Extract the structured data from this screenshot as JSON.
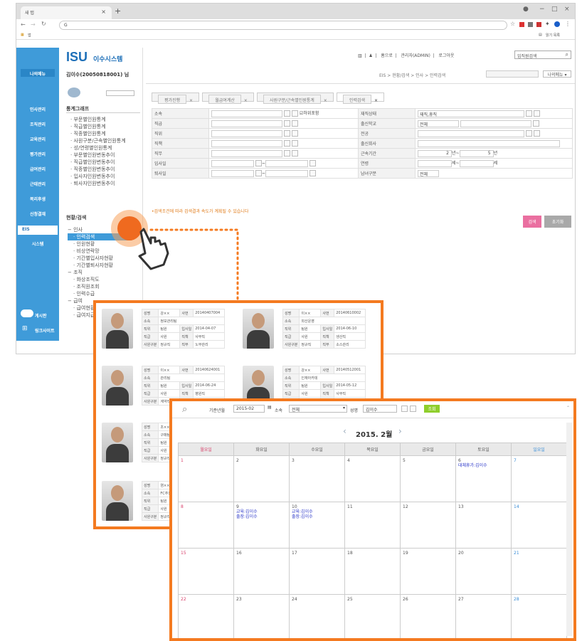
{
  "browser": {
    "tab_title": "새 탭",
    "tab_close": "×",
    "new_tab": "+",
    "url": "G",
    "bookmark_apps": "앱",
    "reading_list": "읽기 목록",
    "window_controls": [
      "−",
      "□",
      "×"
    ]
  },
  "brand": {
    "logo": "ISU",
    "name": "이수시스템",
    "user": "김이수(20050818001) 님",
    "my_menu": "나의메뉴"
  },
  "header": {
    "links": [
      "홈으로",
      "관리자(ADMIN)",
      "로그아웃"
    ],
    "search_placeholder": "임직원검색",
    "breadcrumb": "EIS > 현황/검색 > 인사 > 인력검색",
    "my_menu_btn": "나의메뉴 ▾"
  },
  "leftnav": [
    "인사관리",
    "조직관리",
    "교육관리",
    "평가관리",
    "급여관리",
    "근태관리",
    "복리후생",
    "신청결재",
    "EIS",
    "시스템"
  ],
  "leftnav_bottom": [
    "게시판",
    "링크사이트"
  ],
  "lnb": {
    "stats_title": "통계그래프",
    "stats": [
      "부문별인원통계",
      "직급별인원통계",
      "직종별인원통계",
      "사원구분/근속별인원통계",
      "성/연령별인원통계",
      "부문별인원변동추이",
      "직급별인원변동추이",
      "직종별인원변동추이",
      "입사자인원변동추이",
      "퇴사자인원변동추이"
    ],
    "status_title": "현황/검색",
    "groups": [
      {
        "name": "인사",
        "items": [
          "인력검색",
          "인원현황",
          "비상연락망",
          "기간별입사자현황",
          "기간별퇴사자현황"
        ]
      },
      {
        "name": "조직",
        "items": [
          "화상조직도",
          "조직원조회",
          "인력수급"
        ]
      },
      {
        "name": "급여",
        "items": [
          "급여현황",
          "급여지급"
        ]
      }
    ]
  },
  "tabs": [
    "평가진행",
    "월급여계산",
    "사원구분/근속별인원통계",
    "인력검색"
  ],
  "form": {
    "left": [
      "소속",
      "직급",
      "직위",
      "직책",
      "직무",
      "입사일",
      "퇴사일"
    ],
    "right": [
      "재직상태",
      "출신학교",
      "전공",
      "출신회사",
      "근속기간",
      "연령",
      "남녀구분"
    ],
    "include_sub": "하위포함",
    "status_value": "재직,휴직",
    "school_value": "전체",
    "tenure_from": "2",
    "tenure_unit_year": "년~",
    "tenure_to": "5",
    "tenure_unit": "년",
    "age_unit_a": "세~",
    "age_unit_b": "세",
    "gender_value": "전체",
    "tilde": "~",
    "notice": "•검색조건에 따라 검색결과 속도가 계획될 수 있습니다",
    "search_btn": "검색",
    "reset_btn": "초기화"
  },
  "profile_labels": {
    "name": "성명",
    "empno": "사번",
    "dept": "소속",
    "position": "직위",
    "hire": "입사일",
    "grade": "직급",
    "duty": "직책",
    "type": "사원구분",
    "job": "직무"
  },
  "profiles": [
    {
      "name": "강××",
      "empno": "20140407004",
      "dept": "정보관리팀",
      "position": "팀원",
      "hire": "2014-04-07",
      "grade": "사원",
      "duty": "사무직",
      "type": "정규직",
      "job": "노무관리"
    },
    {
      "name": "이××",
      "empno": "20140610002",
      "dept": "외산운영",
      "position": "팀원",
      "hire": "2014-06-10",
      "grade": "사원",
      "duty": "생산직",
      "type": "정규직",
      "job": "소스관리"
    },
    {
      "name": "이××",
      "empno": "20140624001",
      "dept": "관리팀",
      "position": "팀원",
      "hire": "2014-06-24",
      "grade": "사원",
      "duty": "병원직",
      "type": "계약직",
      "job": ""
    },
    {
      "name": "강××",
      "empno": "20140512001",
      "dept": "인재아카데",
      "position": "팀원",
      "hire": "2014-05-12",
      "grade": "사원",
      "duty": "사무직",
      "type": "",
      "job": ""
    },
    {
      "name": "조××",
      "empno": "",
      "dept": "구매팀",
      "position": "팀원",
      "hire": "",
      "grade": "사원",
      "duty": "",
      "type": "정규직",
      "job": ""
    },
    {
      "name": "염××",
      "empno": "",
      "dept": "FC추진",
      "position": "팀원",
      "hire": "",
      "grade": "사원",
      "duty": "",
      "type": "정규직",
      "job": ""
    }
  ],
  "calendar": {
    "ym_label": "기준년월",
    "ym_value": "2015-02",
    "dept_label": "소속",
    "dept_value": "전체",
    "name_label": "성명",
    "name_value": "김이수",
    "lookup": "조회",
    "title": "2015. 2월",
    "days": [
      "월요일",
      "화요일",
      "수요일",
      "목요일",
      "금요일",
      "토요일",
      "일요일"
    ],
    "weeks": [
      [
        "1",
        "2",
        "3",
        "4",
        "5",
        "6",
        "7"
      ],
      [
        "8",
        "9",
        "10",
        "11",
        "12",
        "13",
        "14"
      ],
      [
        "15",
        "16",
        "17",
        "18",
        "19",
        "20",
        "21"
      ],
      [
        "22",
        "23",
        "24",
        "25",
        "26",
        "27",
        "28"
      ]
    ],
    "events": {
      "w0d5": [
        "대체휴가:김이수"
      ],
      "w1d1": [
        "교육:김이수",
        "출장:김이수"
      ],
      "w1d2": [
        "교육:김이수",
        "출장:김이수"
      ]
    }
  },
  "colors": {
    "accent": "#f47a20",
    "nav": "#3f9bd9",
    "search_btn": "#ea6fa0",
    "reset_btn": "#a9a9a9",
    "lookup": "#8fce2c",
    "sunday": "#d9416b",
    "saturday": "#3a8dd6"
  }
}
